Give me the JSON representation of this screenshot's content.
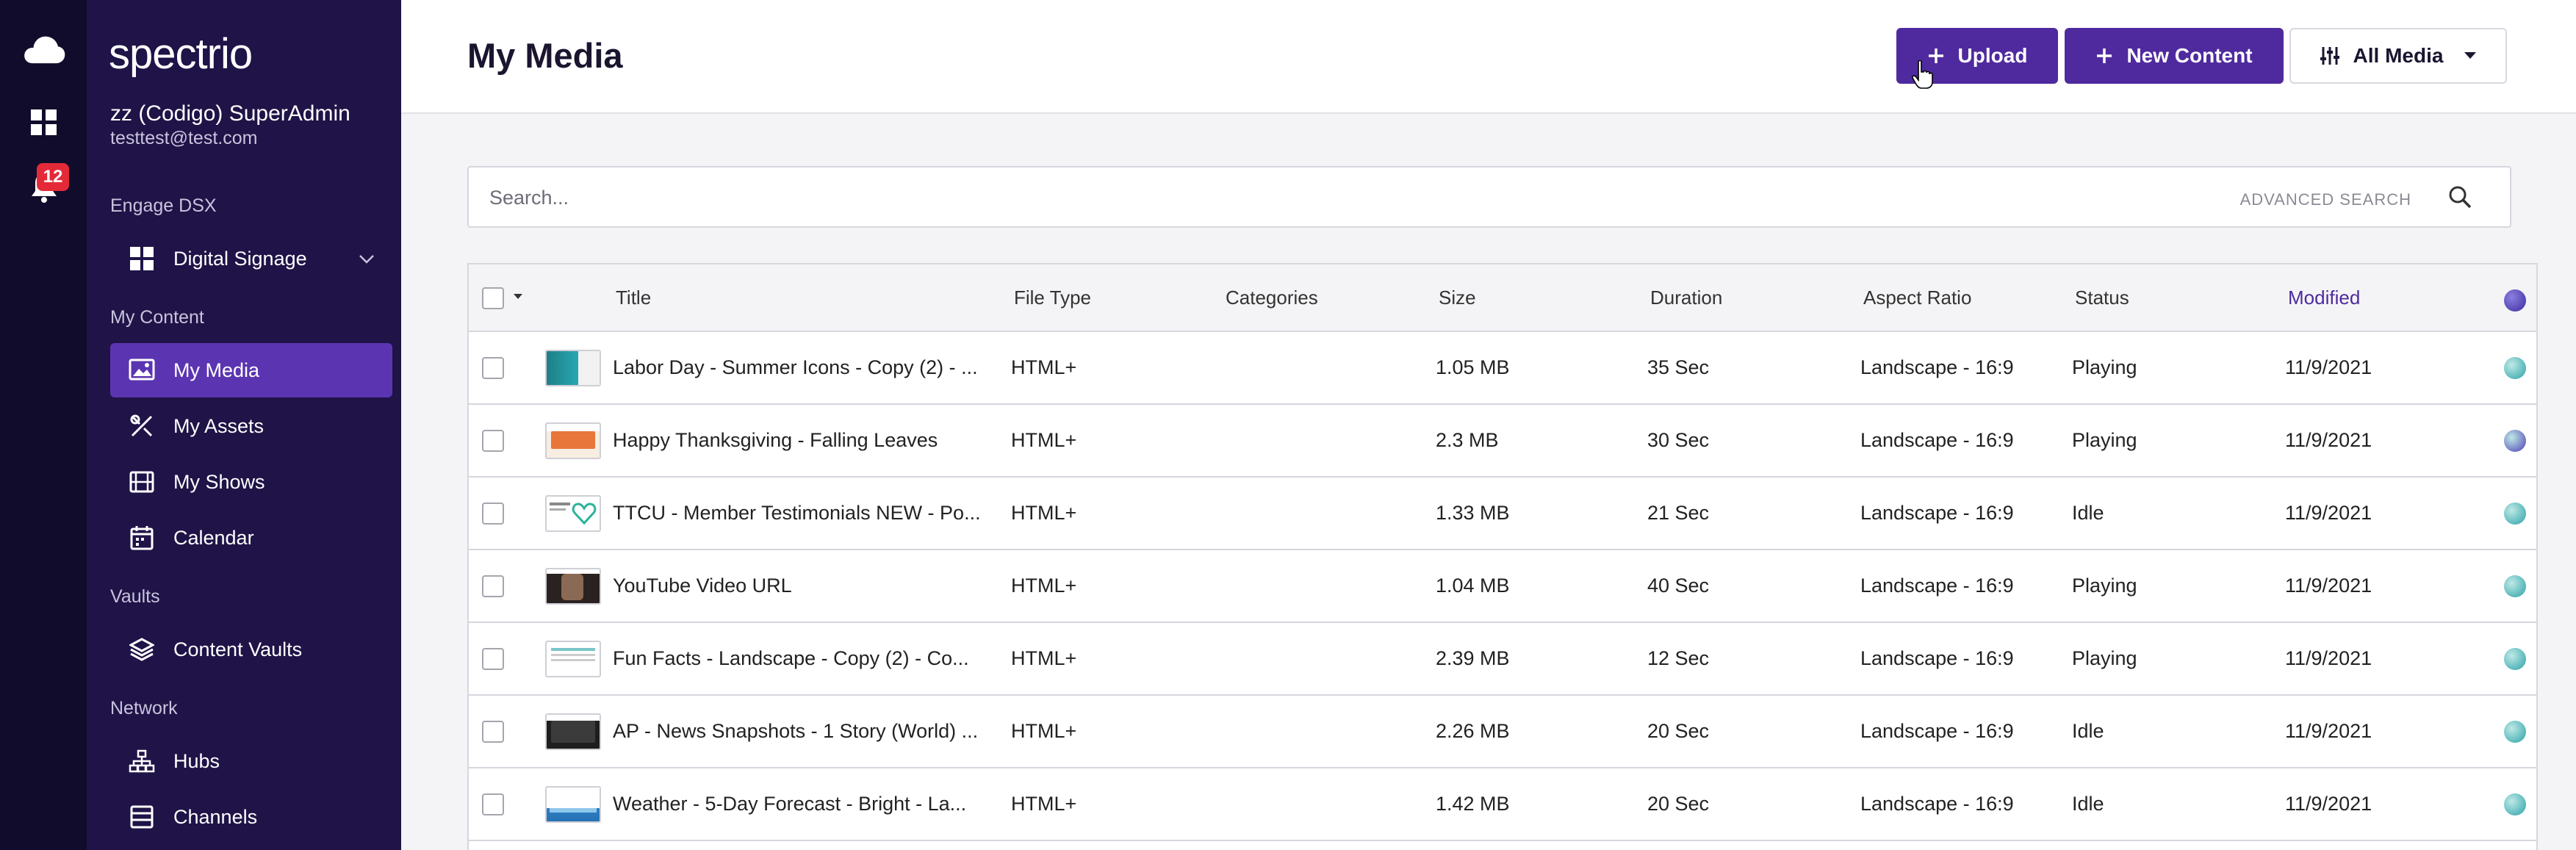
{
  "rail": {
    "notifications_count": "12"
  },
  "brand": {
    "logo_text": "spectrio"
  },
  "user": {
    "name": "zz (Codigo) SuperAdmin",
    "email": "testtest@test.com"
  },
  "sidebar": {
    "sections": [
      "Engage DSX",
      "My Content",
      "Vaults",
      "Network"
    ],
    "items": [
      {
        "label": "Digital Signage",
        "icon": "grid-icon"
      },
      {
        "label": "My Media",
        "icon": "media-icon"
      },
      {
        "label": "My Assets",
        "icon": "assets-icon"
      },
      {
        "label": "My Shows",
        "icon": "film-icon"
      },
      {
        "label": "Calendar",
        "icon": "calendar-icon"
      },
      {
        "label": "Content Vaults",
        "icon": "layers-icon"
      },
      {
        "label": "Hubs",
        "icon": "hub-icon"
      },
      {
        "label": "Channels",
        "icon": "channels-icon"
      }
    ]
  },
  "header": {
    "title": "My Media",
    "upload_label": "Upload",
    "new_content_label": "New Content",
    "filter_label": "All Media"
  },
  "search": {
    "placeholder": "Search...",
    "advanced_label": "ADVANCED SEARCH"
  },
  "table": {
    "columns": [
      "Title",
      "File Type",
      "Categories",
      "Size",
      "Duration",
      "Aspect Ratio",
      "Status",
      "Modified"
    ],
    "sorted_column": "Modified",
    "rows": [
      {
        "title": "Labor Day - Summer Icons - Copy (2) - ...",
        "file_type": "HTML+",
        "categories": "",
        "size": "1.05 MB",
        "duration": "35 Sec",
        "aspect_ratio": "Landscape - 16:9",
        "status": "Playing",
        "modified": "11/9/2021",
        "globe_color": "#2aa2a8",
        "thumb": "summer"
      },
      {
        "title": "Happy Thanksgiving - Falling Leaves",
        "file_type": "HTML+",
        "categories": "",
        "size": "2.3 MB",
        "duration": "30 Sec",
        "aspect_ratio": "Landscape - 16:9",
        "status": "Playing",
        "modified": "11/9/2021",
        "globe_color": "#4b3fb3",
        "thumb": "thanks"
      },
      {
        "title": "TTCU - Member Testimonials NEW - Po...",
        "file_type": "HTML+",
        "categories": "",
        "size": "1.33 MB",
        "duration": "21 Sec",
        "aspect_ratio": "Landscape - 16:9",
        "status": "Idle",
        "modified": "11/9/2021",
        "globe_color": "#2aa2a8",
        "thumb": "ttcu"
      },
      {
        "title": "YouTube Video URL",
        "file_type": "HTML+",
        "categories": "",
        "size": "1.04 MB",
        "duration": "40 Sec",
        "aspect_ratio": "Landscape - 16:9",
        "status": "Playing",
        "modified": "11/9/2021",
        "globe_color": "#2aa2a8",
        "thumb": "youtube"
      },
      {
        "title": "Fun Facts - Landscape - Copy (2) - Co...",
        "file_type": "HTML+",
        "categories": "",
        "size": "2.39 MB",
        "duration": "12 Sec",
        "aspect_ratio": "Landscape - 16:9",
        "status": "Playing",
        "modified": "11/9/2021",
        "globe_color": "#2aa2a8",
        "thumb": "funfacts"
      },
      {
        "title": "AP - News Snapshots - 1 Story (World) ...",
        "file_type": "HTML+",
        "categories": "",
        "size": "2.26 MB",
        "duration": "20 Sec",
        "aspect_ratio": "Landscape - 16:9",
        "status": "Idle",
        "modified": "11/9/2021",
        "globe_color": "#2aa2a8",
        "thumb": "news"
      },
      {
        "title": "Weather - 5-Day Forecast - Bright - La...",
        "file_type": "HTML+",
        "categories": "",
        "size": "1.42 MB",
        "duration": "20 Sec",
        "aspect_ratio": "Landscape - 16:9",
        "status": "Idle",
        "modified": "11/9/2021",
        "globe_color": "#2aa2a8",
        "thumb": "weather"
      }
    ]
  },
  "colors": {
    "accent": "#4f2a9e",
    "sidebar": "#1f1347",
    "rail": "#120c2c",
    "badge": "#e42a38"
  }
}
